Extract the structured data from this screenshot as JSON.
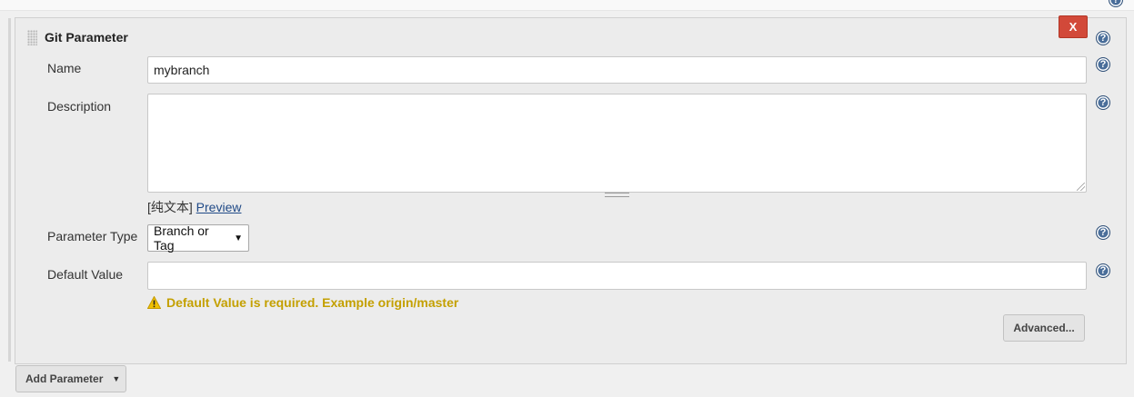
{
  "block": {
    "title": "Git Parameter",
    "delete_label": "X"
  },
  "fields": {
    "name": {
      "label": "Name",
      "value": "mybranch"
    },
    "description": {
      "label": "Description",
      "value": ""
    },
    "markup": {
      "format_label": "[纯文本]",
      "preview_label": "Preview"
    },
    "parameter_type": {
      "label": "Parameter Type",
      "selected": "Branch or Tag"
    },
    "default_value": {
      "label": "Default Value",
      "value": ""
    }
  },
  "warning": {
    "text": "Default Value is required. Example origin/master"
  },
  "buttons": {
    "advanced": "Advanced...",
    "add_parameter": "Add Parameter"
  },
  "help_icon": "?",
  "colors": {
    "delete": "#d24939",
    "warning": "#c4a000",
    "help": "#4a6e9a",
    "link": "#204a87"
  }
}
